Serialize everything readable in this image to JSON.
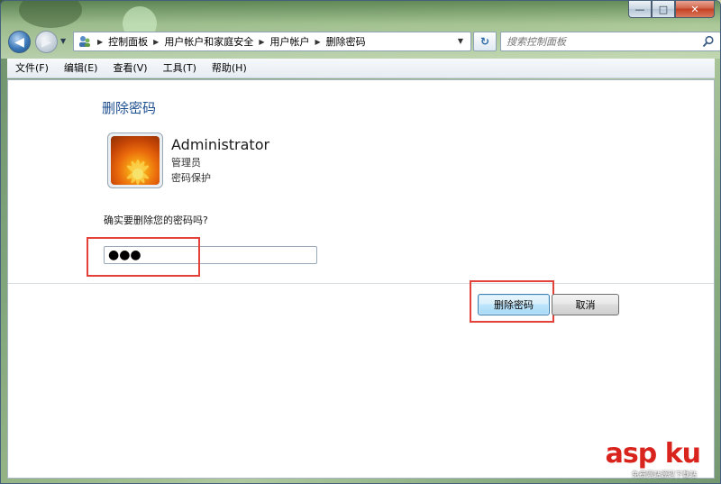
{
  "window": {
    "minimize_glyph": "—",
    "maximize_glyph": "□",
    "close_glyph": "✕"
  },
  "nav": {
    "breadcrumbs": [
      "控制面板",
      "用户帐户和家庭安全",
      "用户帐户",
      "删除密码"
    ],
    "search_placeholder": "搜索控制面板"
  },
  "menu": {
    "items": [
      "文件(F)",
      "编辑(E)",
      "查看(V)",
      "工具(T)",
      "帮助(H)"
    ]
  },
  "page": {
    "title": "删除密码",
    "user_name": "Administrator",
    "user_role": "管理员",
    "user_status": "密码保护",
    "question": "确实要删除您的密码吗?",
    "password_value": "●●●"
  },
  "buttons": {
    "delete_label": "删除密码",
    "cancel_label": "取消"
  },
  "watermark": {
    "logo": "asp ku",
    "sub": "免费网站源码下载站"
  },
  "colors": {
    "highlight": "#e3413a",
    "title_blue": "#1e4f8f"
  }
}
